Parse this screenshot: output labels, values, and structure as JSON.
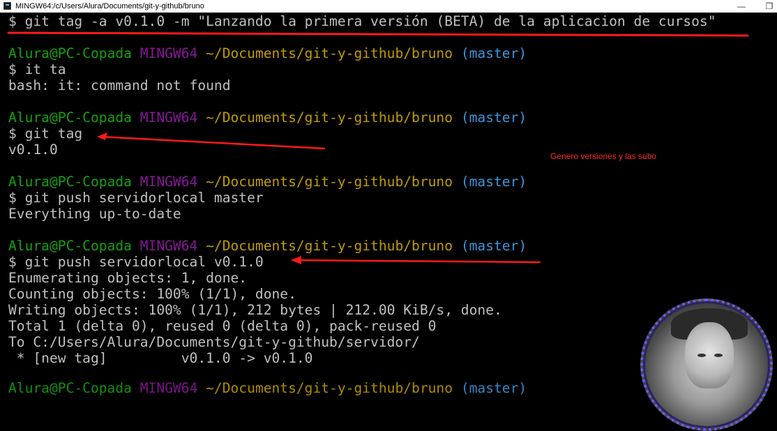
{
  "window": {
    "title": "MINGW64:/c/Users/Alura/Documents/git-y-github/bruno",
    "minimize_glyph": "—",
    "maximize_glyph": "❐"
  },
  "prompt": {
    "user_host": "Alura@PC-Copada",
    "shell": "MINGW64",
    "path": "~/Documents/git-y-github/bruno",
    "branch": "(master)"
  },
  "terminal": {
    "top_command": "$ git tag -a v0.1.0 -m \"Lanzando la primera versión (BETA) de la aplicacion de cursos\"",
    "cmd1": "$ it ta",
    "out1": "bash: it: command not found",
    "cmd2": "$ git tag",
    "out2": "v0.1.0",
    "cmd3": "$ git push servidorlocal master",
    "out3": "Everything up-to-date",
    "cmd4": "$ git push servidorlocal v0.1.0",
    "out4": [
      "Enumerating objects: 1, done.",
      "Counting objects: 100% (1/1), done.",
      "Writing objects: 100% (1/1), 212 bytes | 212.00 KiB/s, done.",
      "Total 1 (delta 0), reused 0 (delta 0), pack-reused 0",
      "To C:/Users/Alura/Documents/git-y-github/servidor/",
      " * [new tag]         v0.1.0 -> v0.1.0"
    ]
  },
  "annotation": {
    "note": "Genero versiones y las subo",
    "color": "#ff2a2a"
  },
  "colors": {
    "background": "#000000",
    "text": "#c0c0c0",
    "user": "#13a10e",
    "host": "#881798",
    "path": "#c19c00",
    "branch": "#3a96dd"
  }
}
